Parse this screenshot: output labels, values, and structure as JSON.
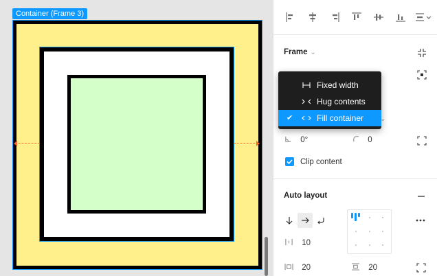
{
  "canvas": {
    "frame_label": "Container (Frame 3)"
  },
  "panel": {
    "frame_section": {
      "title": "Frame"
    },
    "resize_menu": {
      "items": [
        {
          "label": "Fixed width",
          "icon": "fixed-width-icon",
          "selected": false
        },
        {
          "label": "Hug contents",
          "icon": "hug-contents-icon",
          "selected": false
        },
        {
          "label": "Fill container",
          "icon": "fill-container-icon",
          "selected": true
        }
      ]
    },
    "rotation": "0°",
    "corner_radius": "0",
    "clip_content": {
      "label": "Clip content",
      "checked": true
    },
    "auto_layout": {
      "title": "Auto layout",
      "gap": "10",
      "padding_horizontal": "20",
      "padding_vertical": "20"
    }
  },
  "colors": {
    "accent": "#0d99ff",
    "outer_fill": "#fff08c",
    "inner_fill": "#d4ffc8",
    "guide": "#ff6a2b"
  }
}
